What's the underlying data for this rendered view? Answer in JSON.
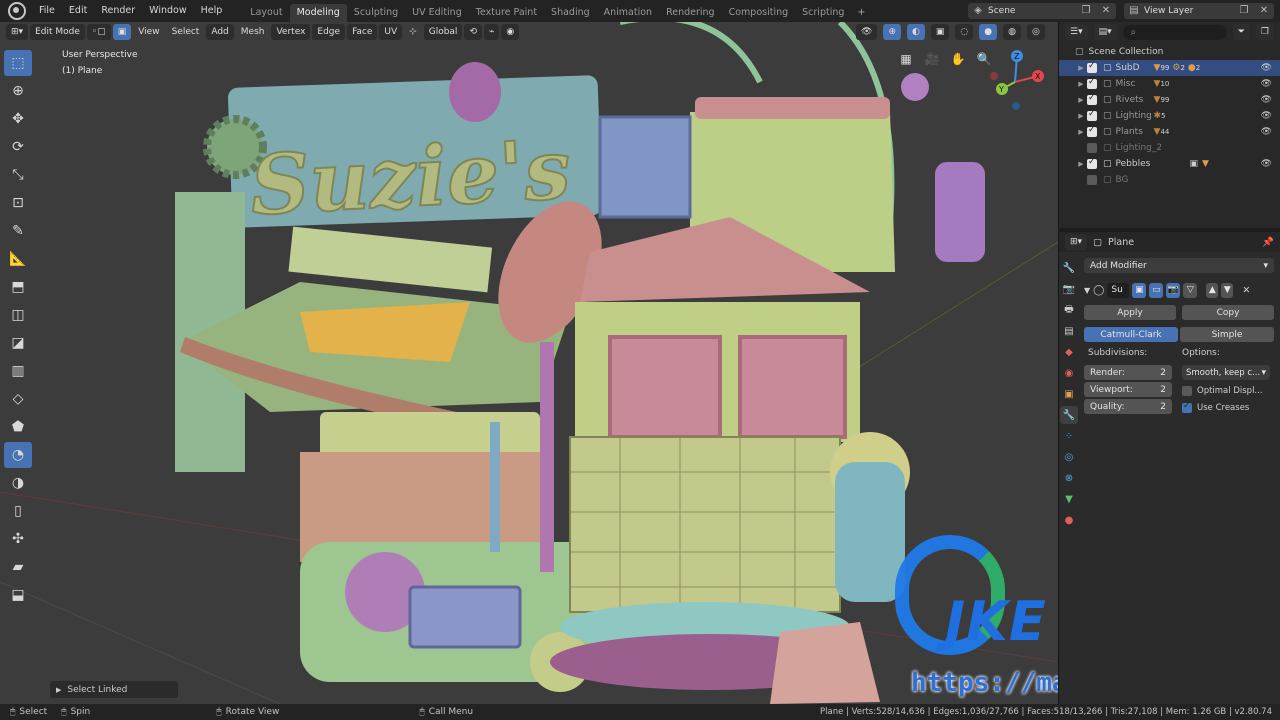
{
  "topbar": {
    "menus": [
      "File",
      "Edit",
      "Render",
      "Window",
      "Help"
    ],
    "workspaces": [
      "Layout",
      "Modeling",
      "Sculpting",
      "UV Editing",
      "Texture Paint",
      "Shading",
      "Animation",
      "Rendering",
      "Compositing",
      "Scripting"
    ],
    "active_workspace": "Modeling",
    "add_workspace": "+",
    "scene": "Scene",
    "view_layer": "View Layer"
  },
  "viewport_header": {
    "mode": "Edit Mode",
    "menus": [
      "View",
      "Select",
      "Add",
      "Mesh",
      "Vertex",
      "Edge",
      "Face",
      "UV"
    ],
    "orientation": "Global"
  },
  "viewport": {
    "perspective": "User Perspective",
    "object": "(1) Plane",
    "sign_text": "Suzie's",
    "last_operator": "Select Linked"
  },
  "gizmo": {
    "x": "X",
    "y": "Y",
    "z": "Z",
    "colors": {
      "x": "#e0484b",
      "y": "#8cc63f",
      "z": "#3d8ee6"
    }
  },
  "watermark": {
    "logo": "JKE下载站",
    "url": "https://mac.arthaskj.top"
  },
  "outliner": {
    "root": "Scene Collection",
    "items": [
      {
        "name": "SubD",
        "checked": true,
        "selected": true,
        "badges": [
          "99",
          "2",
          "2"
        ]
      },
      {
        "name": "Misc",
        "checked": true,
        "badges": [
          "10"
        ]
      },
      {
        "name": "Rivets",
        "checked": true,
        "badges": [
          "99"
        ]
      },
      {
        "name": "Lighting",
        "checked": true,
        "badges": [
          "5"
        ]
      },
      {
        "name": "Plants",
        "checked": true,
        "badges": [
          "44"
        ]
      },
      {
        "name": "Lighting_2",
        "checked": false,
        "badges": []
      },
      {
        "name": "Pebbles",
        "checked": true,
        "badges": []
      },
      {
        "name": "BG",
        "checked": false,
        "badges": []
      }
    ]
  },
  "properties": {
    "object": "Plane",
    "add_modifier": "Add Modifier",
    "modifier_name": "Su",
    "apply": "Apply",
    "copy": "Copy",
    "catmull": "Catmull-Clark",
    "simple": "Simple",
    "subdivisions_label": "Subdivisions:",
    "options_label": "Options:",
    "render_label": "Render:",
    "render_value": "2",
    "viewport_label": "Viewport:",
    "viewport_value": "2",
    "quality_label": "Quality:",
    "quality_value": "2",
    "smooth": "Smooth, keep c...",
    "optimal": "Optimal Displ...",
    "use_creases": "Use Creases"
  },
  "statusbar": {
    "select": "Select",
    "spin": "Spin",
    "rotate": "Rotate View",
    "call_menu": "Call Menu",
    "stats": "Plane | Verts:528/14,636 | Edges:1,036/27,766 | Faces:518/13,266 | Tris:27,108 | Mem: 1.26 GB | v2.80.74"
  }
}
